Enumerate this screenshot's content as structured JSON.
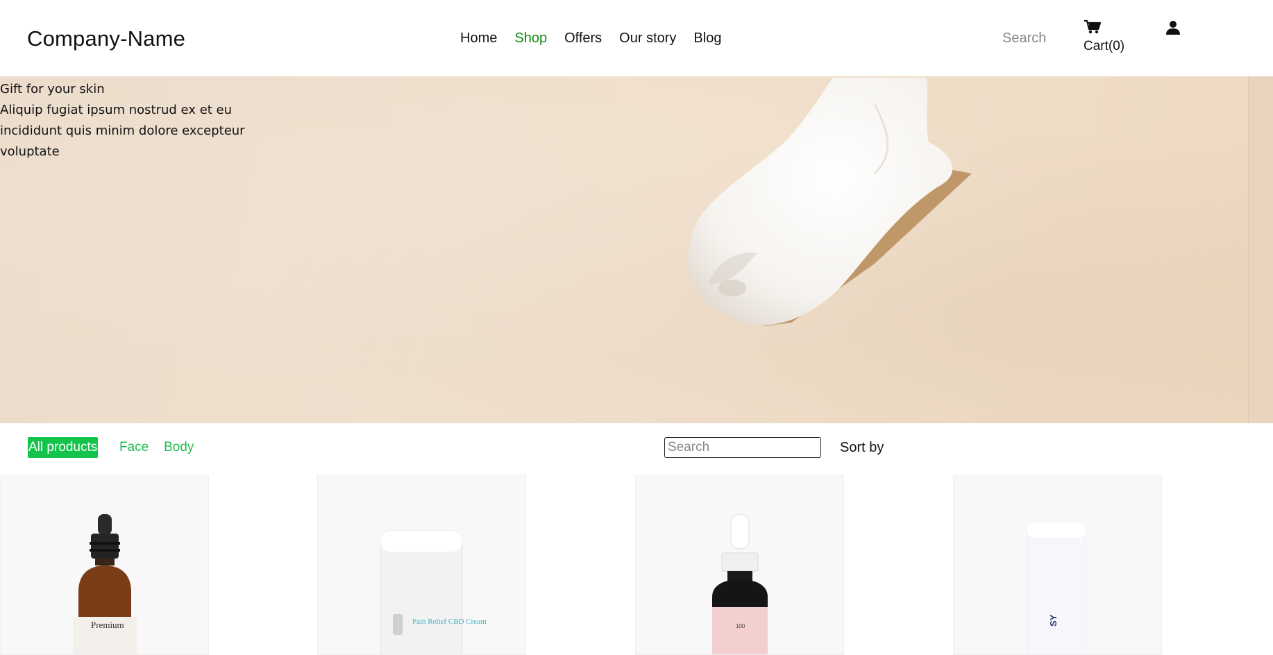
{
  "header": {
    "logo": "Company-Name",
    "nav": [
      {
        "label": "Home",
        "active": false
      },
      {
        "label": "Shop",
        "active": true
      },
      {
        "label": "Offers",
        "active": false
      },
      {
        "label": "Our story",
        "active": false
      },
      {
        "label": "Blog",
        "active": false
      }
    ],
    "search_label": "Search",
    "cart_label": "Cart(0)",
    "icons": {
      "cart": "cart-icon",
      "user": "user-icon"
    }
  },
  "hero": {
    "title": "Gift for your skin",
    "body": "Aliquip fugiat ipsum nostrud ex et eu incididunt quis minim dolore excepteur voluptate"
  },
  "filters": {
    "categories": [
      {
        "label": "All products",
        "active": true
      },
      {
        "label": "Face",
        "active": false
      },
      {
        "label": "Body",
        "active": false
      }
    ],
    "search_placeholder": "Search",
    "sort_label": "Sort by"
  },
  "products": [
    {
      "type": "dropper-bottle-amber",
      "label_text": "Premium"
    },
    {
      "type": "roll-on-tube",
      "label_text": "Pain Relief CBD Cream"
    },
    {
      "type": "dropper-bottle-pink",
      "label_text": "100"
    },
    {
      "type": "white-tube",
      "label_text": "SY"
    }
  ],
  "colors": {
    "accent_green": "#13c34b",
    "nav_active": "#138a13",
    "hero_bg": "#eddccb"
  }
}
